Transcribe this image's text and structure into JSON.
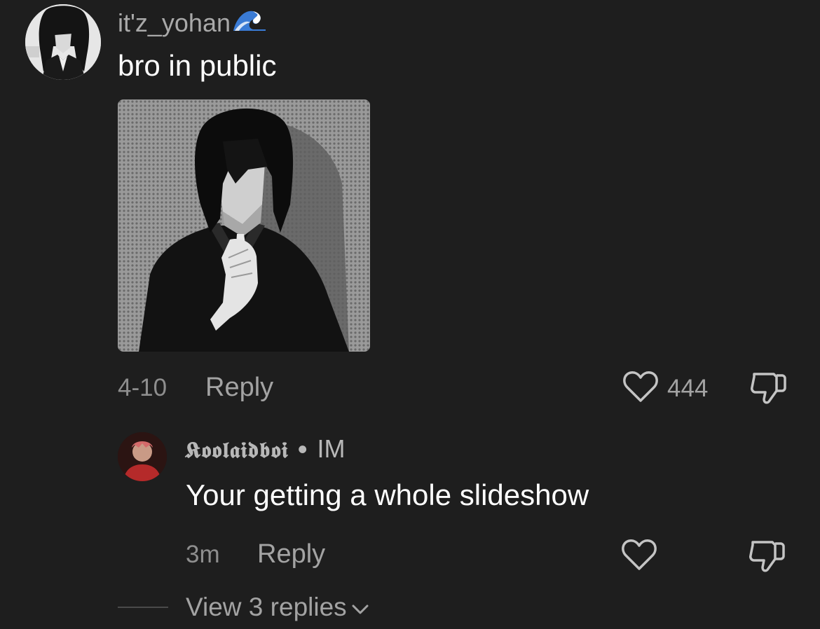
{
  "comment": {
    "username": "it'z_yohan",
    "username_icon": "wave-icon",
    "text": "bro in public",
    "date": "4-10",
    "reply_label": "Reply",
    "like_icon": "heart-icon",
    "like_count": "444",
    "dislike_icon": "thumbs-down-icon"
  },
  "reply": {
    "username": "𝕶𝖔𝖔𝖑𝖆𝖎𝖉𝖇𝖔𝖎",
    "separator": "•",
    "tag": "IM",
    "text": "Your getting a whole slideshow",
    "time": "3m",
    "reply_label": "Reply",
    "like_icon": "heart-icon",
    "dislike_icon": "thumbs-down-icon"
  },
  "view_replies": {
    "label": "View 3 replies",
    "icon": "chevron-down-icon"
  },
  "colors": {
    "background": "#1e1e1e",
    "primary_text": "#ffffff",
    "secondary_text": "#a3a3a3",
    "muted_text": "#8e8e8e"
  }
}
